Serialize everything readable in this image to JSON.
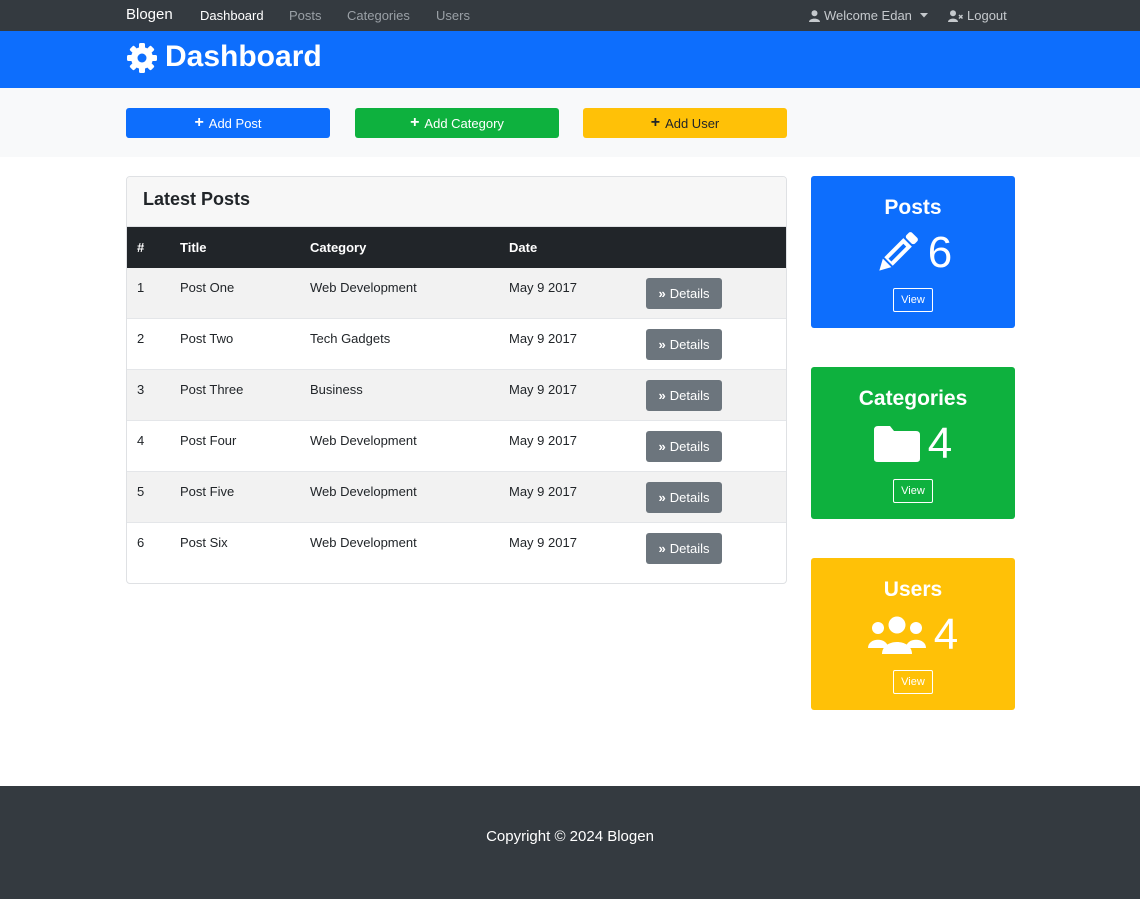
{
  "navbar": {
    "brand": "Blogen",
    "links": [
      {
        "label": "Dashboard",
        "active": true
      },
      {
        "label": "Posts",
        "active": false
      },
      {
        "label": "Categories",
        "active": false
      },
      {
        "label": "Users",
        "active": false
      }
    ],
    "welcome_label": "Welcome Edan",
    "logout_label": "Logout"
  },
  "header": {
    "title": "Dashboard",
    "icon": "gear-icon"
  },
  "actions": {
    "add_post": "Add Post",
    "add_category": "Add Category",
    "add_user": "Add User"
  },
  "latest_posts": {
    "title": "Latest Posts",
    "columns": [
      "#",
      "Title",
      "Category",
      "Date"
    ],
    "rows": [
      {
        "num": "1",
        "title": "Post One",
        "category": "Web Development",
        "date": "May 9 2017",
        "action": "Details"
      },
      {
        "num": "2",
        "title": "Post Two",
        "category": "Tech Gadgets",
        "date": "May 9 2017",
        "action": "Details"
      },
      {
        "num": "3",
        "title": "Post Three",
        "category": "Business",
        "date": "May 9 2017",
        "action": "Details"
      },
      {
        "num": "4",
        "title": "Post Four",
        "category": "Web Development",
        "date": "May 9 2017",
        "action": "Details"
      },
      {
        "num": "5",
        "title": "Post Five",
        "category": "Web Development",
        "date": "May 9 2017",
        "action": "Details"
      },
      {
        "num": "6",
        "title": "Post Six",
        "category": "Web Development",
        "date": "May 9 2017",
        "action": "Details"
      }
    ]
  },
  "stats": [
    {
      "title": "Posts",
      "count": "6",
      "view": "View",
      "icon": "pencil-icon",
      "color": "#0d6efd"
    },
    {
      "title": "Categories",
      "count": "4",
      "view": "View",
      "icon": "folder-icon",
      "color": "#0eb13e"
    },
    {
      "title": "Users",
      "count": "4",
      "view": "View",
      "icon": "users-icon",
      "color": "#ffc107"
    }
  ],
  "footer": {
    "copyright": "Copyright © 2024 Blogen"
  }
}
